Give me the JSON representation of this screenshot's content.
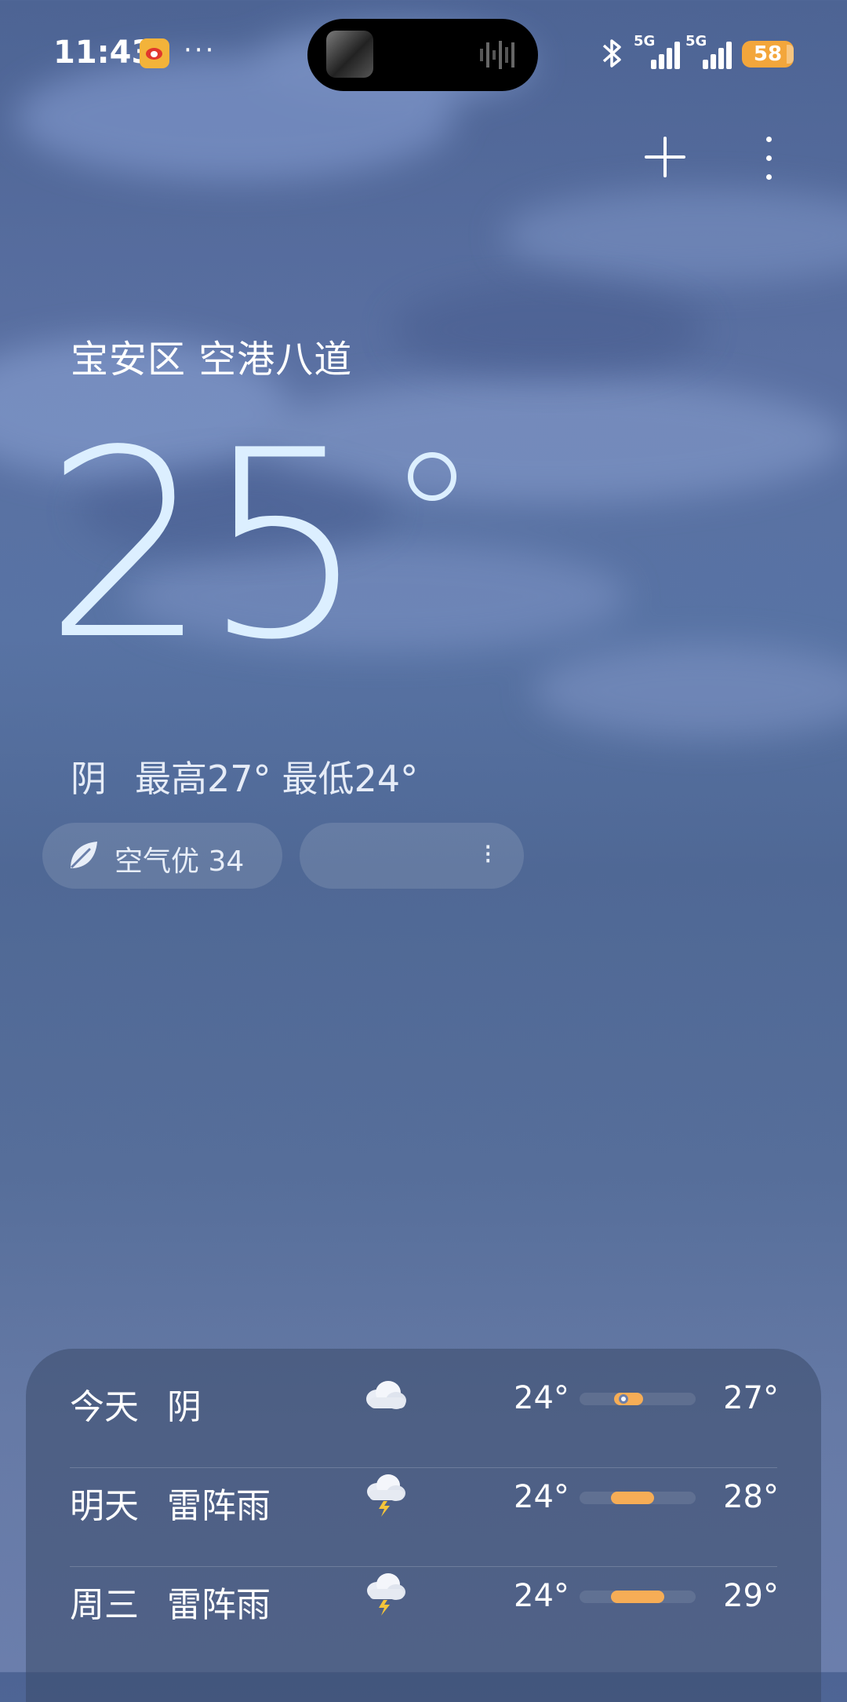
{
  "status_bar": {
    "time": "11:43",
    "network_1": "5G",
    "network_2": "5G",
    "battery": "58",
    "accent_battery": "#f3a63b"
  },
  "location": "宝安区 空港八道",
  "current": {
    "temperature": "25",
    "condition": "阴",
    "high": "最高27°",
    "low": "最低24°"
  },
  "pills": {
    "air_quality": "空气优 34",
    "second": "⁝"
  },
  "forecast": [
    {
      "day": "今天",
      "condition": "阴",
      "icon": "cloud-icon",
      "low": "24°",
      "high": "27°",
      "range_start": 0.3,
      "range_end": 0.55,
      "current_marker": 0.38
    },
    {
      "day": "明天",
      "condition": "雷阵雨",
      "icon": "thunderstorm-icon",
      "low": "24°",
      "high": "28°",
      "range_start": 0.27,
      "range_end": 0.64
    },
    {
      "day": "周三",
      "condition": "雷阵雨",
      "icon": "thunderstorm-icon",
      "low": "24°",
      "high": "29°",
      "range_start": 0.27,
      "range_end": 0.73
    }
  ]
}
